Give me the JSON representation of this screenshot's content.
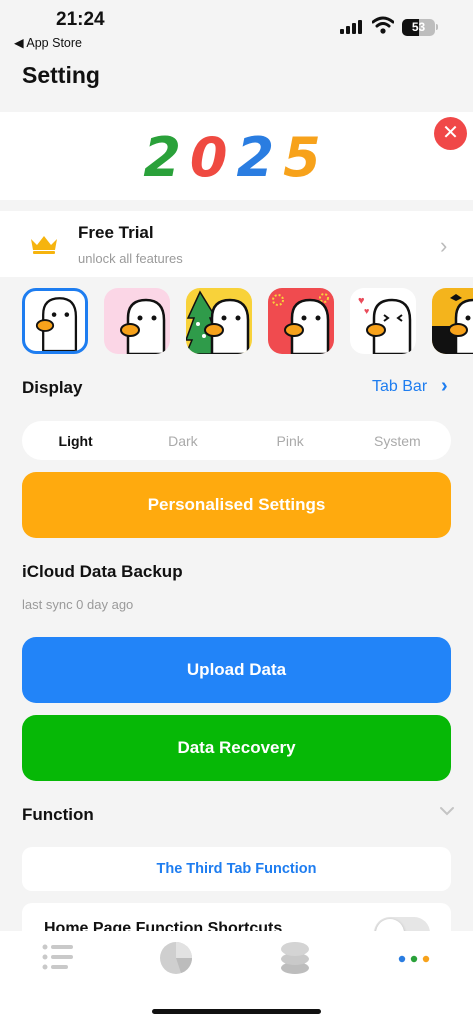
{
  "status_bar": {
    "time": "21:24",
    "back_label": "◀ App Store",
    "battery": "53"
  },
  "page": {
    "title": "Setting"
  },
  "banner": {
    "year_digits": [
      {
        "char": "2",
        "color": "#2aa13a"
      },
      {
        "char": "0",
        "color": "#ef4a41"
      },
      {
        "char": "2",
        "color": "#2a7de1"
      },
      {
        "char": "5",
        "color": "#f7a21b"
      }
    ],
    "close_icon": "close-icon"
  },
  "trial": {
    "title": "Free Trial",
    "subtitle": "unlock all features",
    "icon": "crown-icon"
  },
  "app_icons": [
    {
      "name": "app-icon-white",
      "bg": "#ffffff",
      "selected": true
    },
    {
      "name": "app-icon-pink",
      "bg": "#fbd6e6",
      "selected": false
    },
    {
      "name": "app-icon-christmas",
      "bg": "#f8d23a",
      "selected": false
    },
    {
      "name": "app-icon-red",
      "bg": "#f04b4f",
      "selected": false
    },
    {
      "name": "app-icon-hearts",
      "bg": "#ffffff",
      "selected": false
    },
    {
      "name": "app-icon-halloween",
      "bg": "#f4b41c",
      "selected": false
    }
  ],
  "display": {
    "label": "Display",
    "tab_bar_link": "Tab Bar",
    "themes": [
      "Light",
      "Dark",
      "Pink",
      "System"
    ],
    "active_theme": "Light"
  },
  "personalised_button": "Personalised Settings",
  "icloud": {
    "title": "iCloud Data Backup",
    "last_sync": "last sync 0 day ago",
    "upload_button": "Upload Data",
    "recovery_button": "Data Recovery"
  },
  "function": {
    "label": "Function",
    "third_tab": "The Third Tab Function",
    "shortcuts_label": "Home Page Function Shortcuts"
  },
  "colors": {
    "accent": "#1e7df0",
    "orange": "#ffaa0e",
    "blue": "#2284f8",
    "green": "#06b806"
  },
  "bottom_nav": [
    "list-icon",
    "pie-chart-icon",
    "database-icon",
    "more-dots-icon"
  ]
}
